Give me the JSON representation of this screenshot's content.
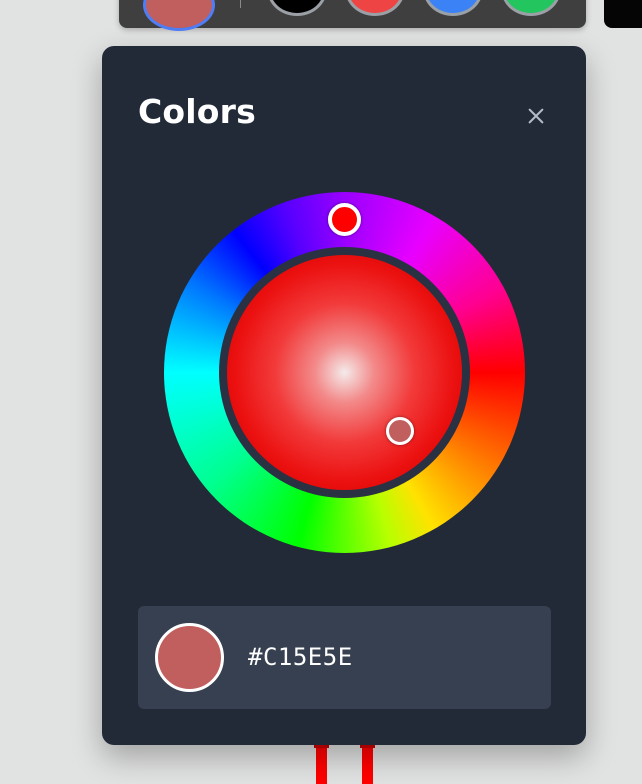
{
  "toolbar": {
    "swatches": [
      {
        "name": "current",
        "color": "#c15e5e"
      },
      {
        "name": "black",
        "color": "#000000"
      },
      {
        "name": "red",
        "color": "#ef4444"
      },
      {
        "name": "blue",
        "color": "#3b82f6"
      },
      {
        "name": "green",
        "color": "#22c55e"
      }
    ]
  },
  "panel": {
    "title": "Colors",
    "close_icon": "close-icon"
  },
  "picker": {
    "hue_color": "#ff0000",
    "selected_color": "#c15e5e"
  },
  "selected": {
    "hex": "#C15E5E",
    "color": "#c15e5e"
  }
}
